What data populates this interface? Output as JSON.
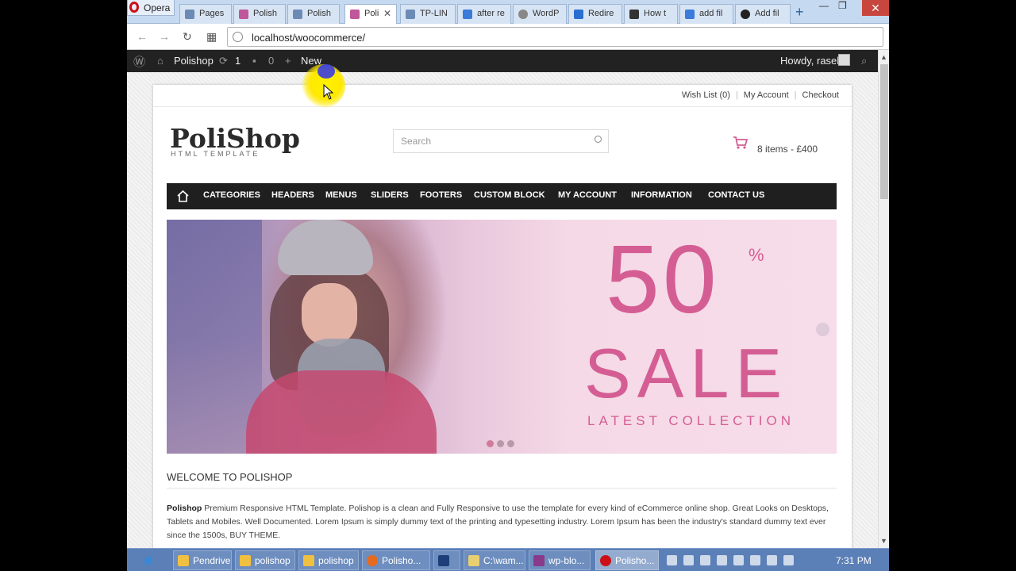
{
  "browser": {
    "menu_label": "Opera",
    "tabs": [
      {
        "label": "Pages",
        "color": "#6b8bb5"
      },
      {
        "label": "Polish",
        "color": "#c0579a"
      },
      {
        "label": "Polish",
        "color": "#6b8bb5"
      },
      {
        "label": "Poli",
        "color": "#c0579a"
      },
      {
        "label": "TP-LIN",
        "color": "#6b8bb5"
      },
      {
        "label": "after re",
        "color": "#3b7bd9"
      },
      {
        "label": "WordP",
        "color": "#888888"
      },
      {
        "label": "Redire",
        "color": "#2a6ed0"
      },
      {
        "label": "How t",
        "color": "#333333"
      },
      {
        "label": "add fil",
        "color": "#3b7bd9"
      },
      {
        "label": "Add fil",
        "color": "#222222"
      }
    ],
    "new_tab": "+",
    "url": "localhost/woocommerce/",
    "accent": "#c5d9f1"
  },
  "wpbar": {
    "site_name": "Polishop",
    "updates": "1",
    "comments": "0",
    "new_label": "New",
    "greeting": "Howdy, rasel"
  },
  "store": {
    "toplinks": [
      "Wish List (0)",
      "My Account",
      "Checkout"
    ],
    "logo": "PoliShop",
    "tagline": "HTML TEMPLATE",
    "search_placeholder": "Search",
    "cart_summary": "8 items - £400",
    "menu": [
      "CATEGORIES",
      "HEADERS",
      "MENUS",
      "SLIDERS",
      "FOOTERS",
      "CUSTOM BLOCK",
      "MY ACCOUNT",
      "INFORMATION",
      "CONTACT US"
    ],
    "banner": {
      "big": "50",
      "pct": "%",
      "sale": "SALE",
      "collection": "LATEST COLLECTION",
      "accent": "#d45e93"
    },
    "welcome_title": "WELCOME TO POLISHOP",
    "desc_bold": "Polishop",
    "desc_text": " Premium Responsive HTML Template. Polishop is a clean and Fully Responsive to use the template for every kind of eCommerce online shop. Great Looks on Desktops, Tablets and Mobiles. Well Documented. Lorem Ipsum is simply dummy text of the printing and typesetting industry. Lorem Ipsum has been the industry's standard dummy text ever since the 1500s, BUY THEME."
  },
  "taskbar": {
    "items": [
      "Pendrive",
      "polishop",
      "polishop",
      "Polisho...",
      "",
      "C:\\wam...",
      "wp-blo...",
      "Polisho..."
    ],
    "clock": "7:31 PM"
  }
}
